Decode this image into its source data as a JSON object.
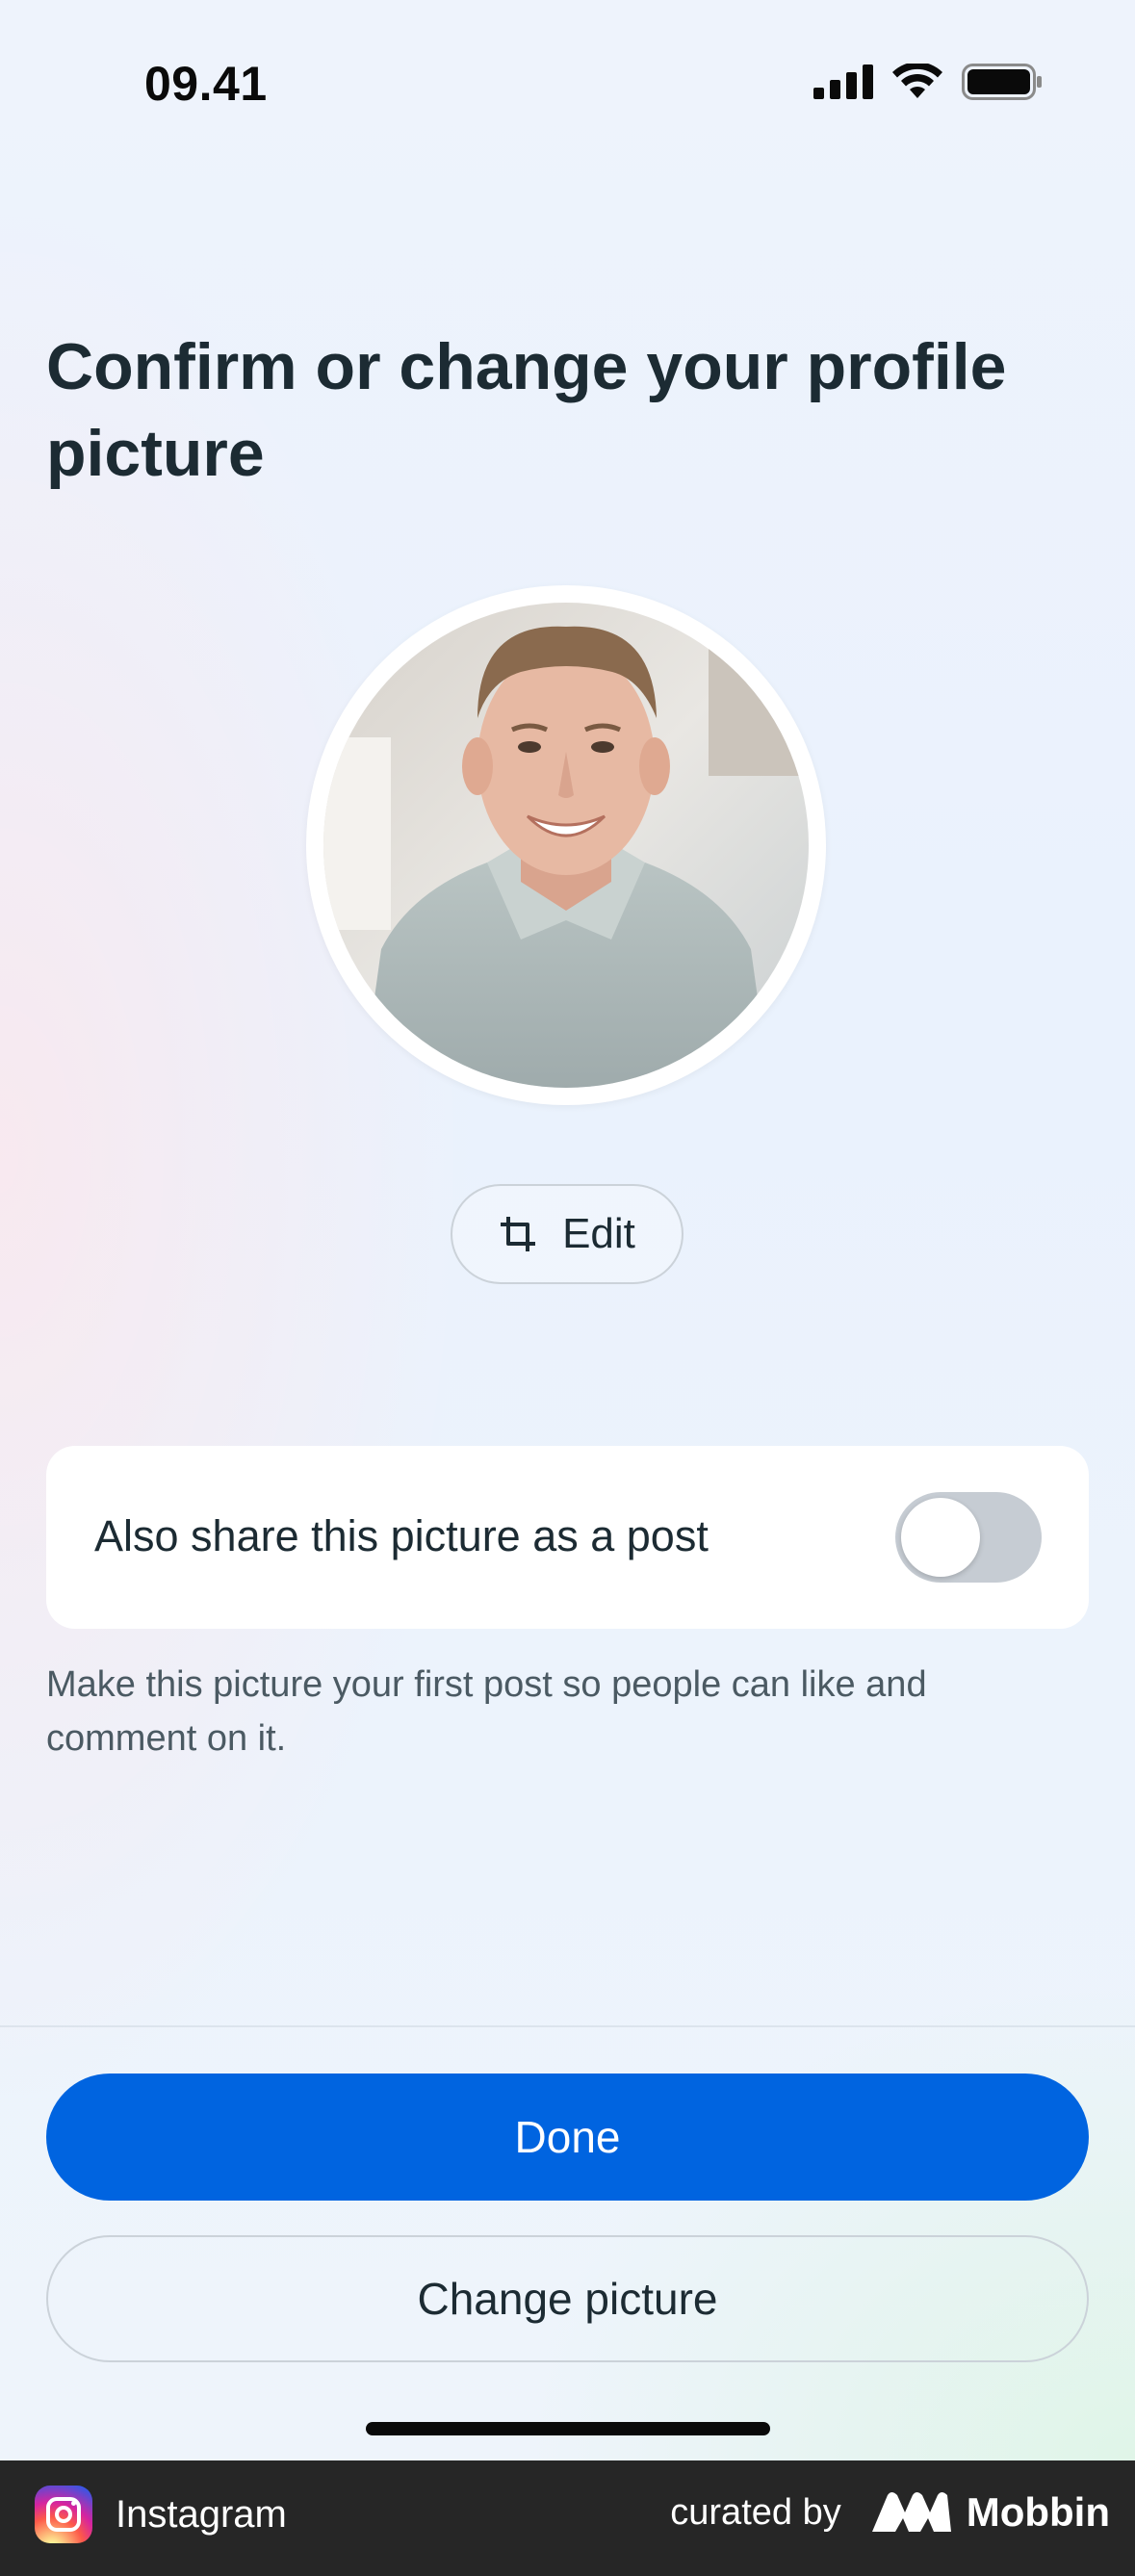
{
  "status_bar": {
    "time": "09.41",
    "icons": [
      "cellular-signal-icon",
      "wifi-icon",
      "battery-icon"
    ]
  },
  "page": {
    "title": "Confirm or change your profile picture",
    "edit_label": "Edit",
    "share_label": "Also share this picture as a post",
    "share_toggle_on": false,
    "helper_text": "Make this picture your first post so people can like and comment on it."
  },
  "actions": {
    "done_label": "Done",
    "change_label": "Change picture"
  },
  "footer": {
    "app_name": "Instagram",
    "curated_by": "curated by",
    "brand": "Mobbin"
  },
  "colors": {
    "primary": "#0064e0",
    "text": "#1c2b33",
    "toggle_off": "#c6ccd3",
    "footer_bg": "#262626"
  }
}
